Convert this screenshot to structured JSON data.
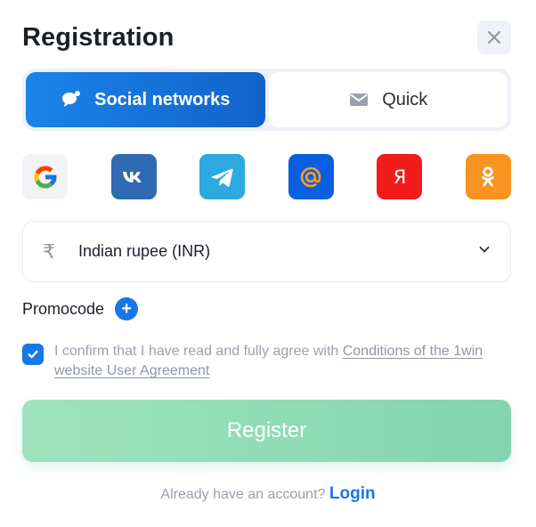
{
  "header": {
    "title": "Registration"
  },
  "tabs": [
    {
      "label": "Social networks",
      "icon": "chat-bubble-icon",
      "active": true
    },
    {
      "label": "Quick",
      "icon": "envelope-icon",
      "active": false
    }
  ],
  "socials": [
    {
      "name": "google",
      "icon": "google-icon",
      "color": "#f1f3f6"
    },
    {
      "name": "vk",
      "icon": "vk-icon",
      "color": "#2f6ab3"
    },
    {
      "name": "telegram",
      "icon": "telegram-icon",
      "color": "#2ca9e0"
    },
    {
      "name": "mail",
      "icon": "at-sign-icon",
      "color": "#0a5fe0"
    },
    {
      "name": "yandex",
      "icon": "yandex-icon",
      "color": "#f21b1b",
      "glyph": "Я"
    },
    {
      "name": "odnoklassniki",
      "icon": "odnoklassniki-icon",
      "color": "#f7931e"
    }
  ],
  "currency": {
    "symbol": "₹",
    "label": "Indian rupee (INR)"
  },
  "promo": {
    "label": "Promocode",
    "plus": "+"
  },
  "agreement": {
    "checked": true,
    "text": "I confirm that I have read and fully agree with ",
    "link": "Conditions of the 1win website User Agreement"
  },
  "register": {
    "label": "Register",
    "color": "#8fdcb4"
  },
  "footer": {
    "text": "Already have an account?",
    "login": "Login"
  },
  "colors": {
    "accent": "#1677e6",
    "tab_active": "#1a84e8",
    "panel": "#eef1f7"
  }
}
